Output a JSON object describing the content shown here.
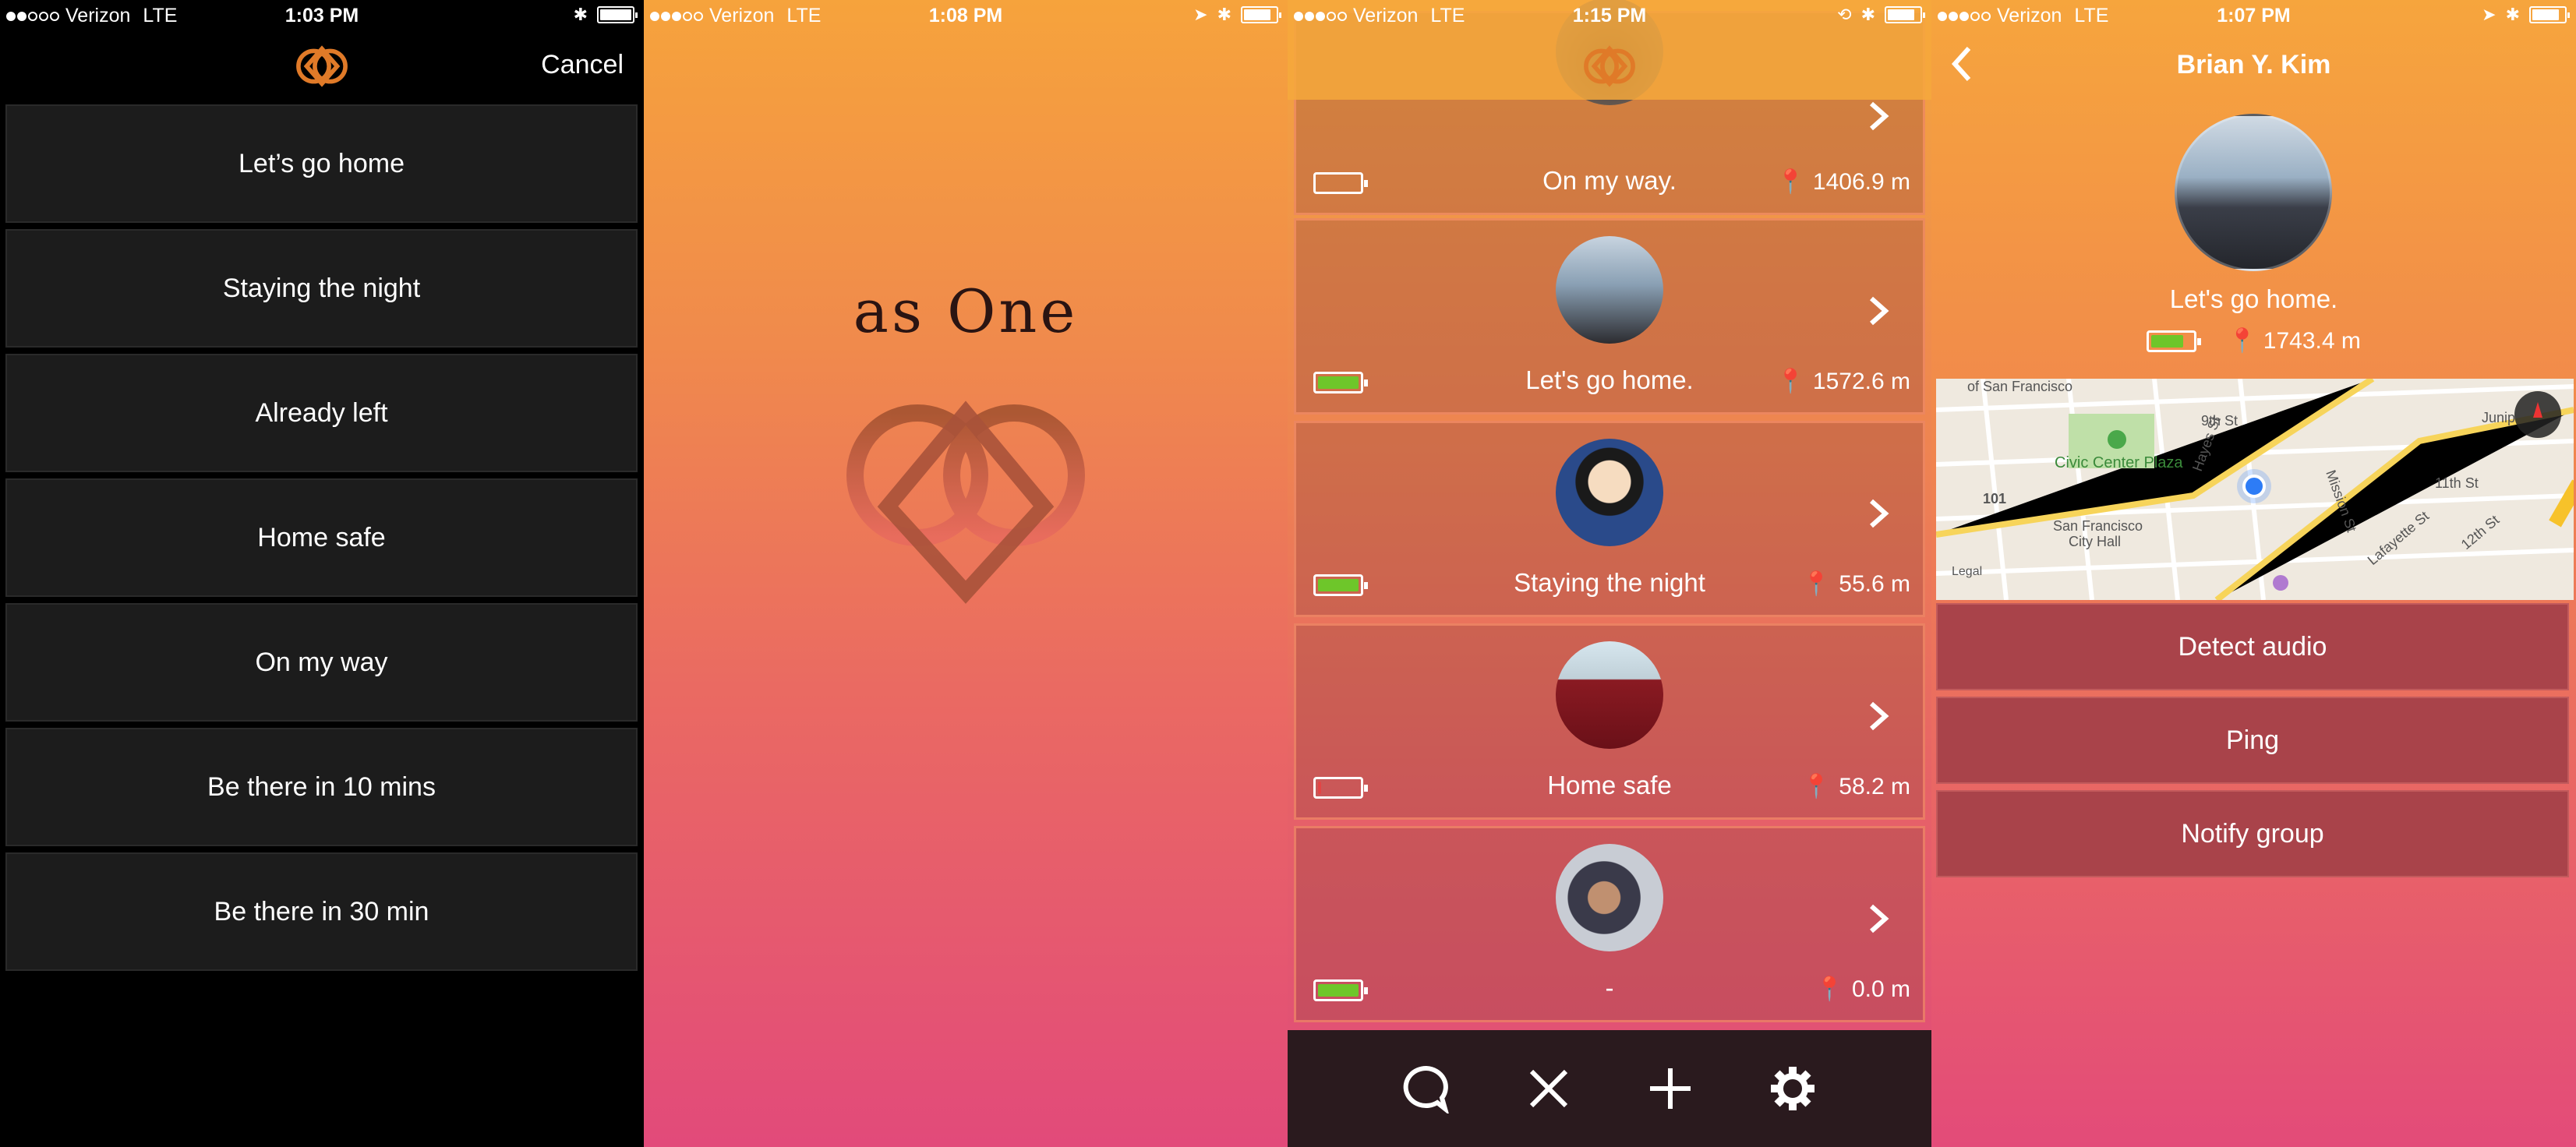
{
  "screen1": {
    "status": {
      "carrier": "Verizon",
      "network": "LTE",
      "time": "1:03 PM"
    },
    "cancel_label": "Cancel",
    "messages": [
      "Let’s go home",
      "Staying the night",
      "Already left",
      "Home safe",
      "On my way",
      "Be there in 10 mins",
      "Be there in 30 min"
    ]
  },
  "screen2": {
    "status": {
      "carrier": "Verizon",
      "network": "LTE",
      "time": "1:08 PM"
    },
    "app_title": "as One"
  },
  "screen3": {
    "status": {
      "carrier": "Verizon",
      "network": "LTE",
      "time": "1:15 PM"
    },
    "members": [
      {
        "status": "On my way.",
        "distance": "1406.9 m",
        "battery_level": 0.0,
        "battery": "empty",
        "avatar": "person-at-laptop"
      },
      {
        "status": "Let's go home.",
        "distance": "1572.6 m",
        "battery_level": 0.8,
        "battery": "green",
        "avatar": "couple-on-bridge"
      },
      {
        "status": "Staying the night",
        "distance": "55.6 m",
        "battery_level": 0.8,
        "battery": "green",
        "avatar": "cartoon-character"
      },
      {
        "status": "Home safe",
        "distance": "58.2 m",
        "battery_level": 0.05,
        "battery": "red",
        "avatar": "soccer-player"
      },
      {
        "status": "-",
        "distance": "0.0 m",
        "battery_level": 0.8,
        "battery": "green",
        "avatar": "man-with-guitar"
      }
    ],
    "tabs": [
      "chat-icon",
      "close-icon",
      "add-icon",
      "settings-icon"
    ]
  },
  "screen4": {
    "status": {
      "carrier": "Verizon",
      "network": "LTE",
      "time": "1:07 PM"
    },
    "title": "Brian Y. Kim",
    "user_status": "Let's go home.",
    "distance": "1743.4 m",
    "battery_level": 0.7,
    "map": {
      "labels": [
        "of San Francisco",
        "Civic Center Plaza",
        "San Francisco",
        "City Hall",
        "101",
        "9th St",
        "Hayes St",
        "Mission St",
        "11th St",
        "12th St",
        "Lafayette St",
        "Legal",
        "Junip"
      ]
    },
    "actions": [
      "Detect audio",
      "Ping",
      "Notify group"
    ]
  },
  "colors": {
    "accent_orange": "#f08a3c",
    "battery_green": "#6ec62a",
    "battery_red": "#e34545",
    "card_border": "#f79a72"
  }
}
